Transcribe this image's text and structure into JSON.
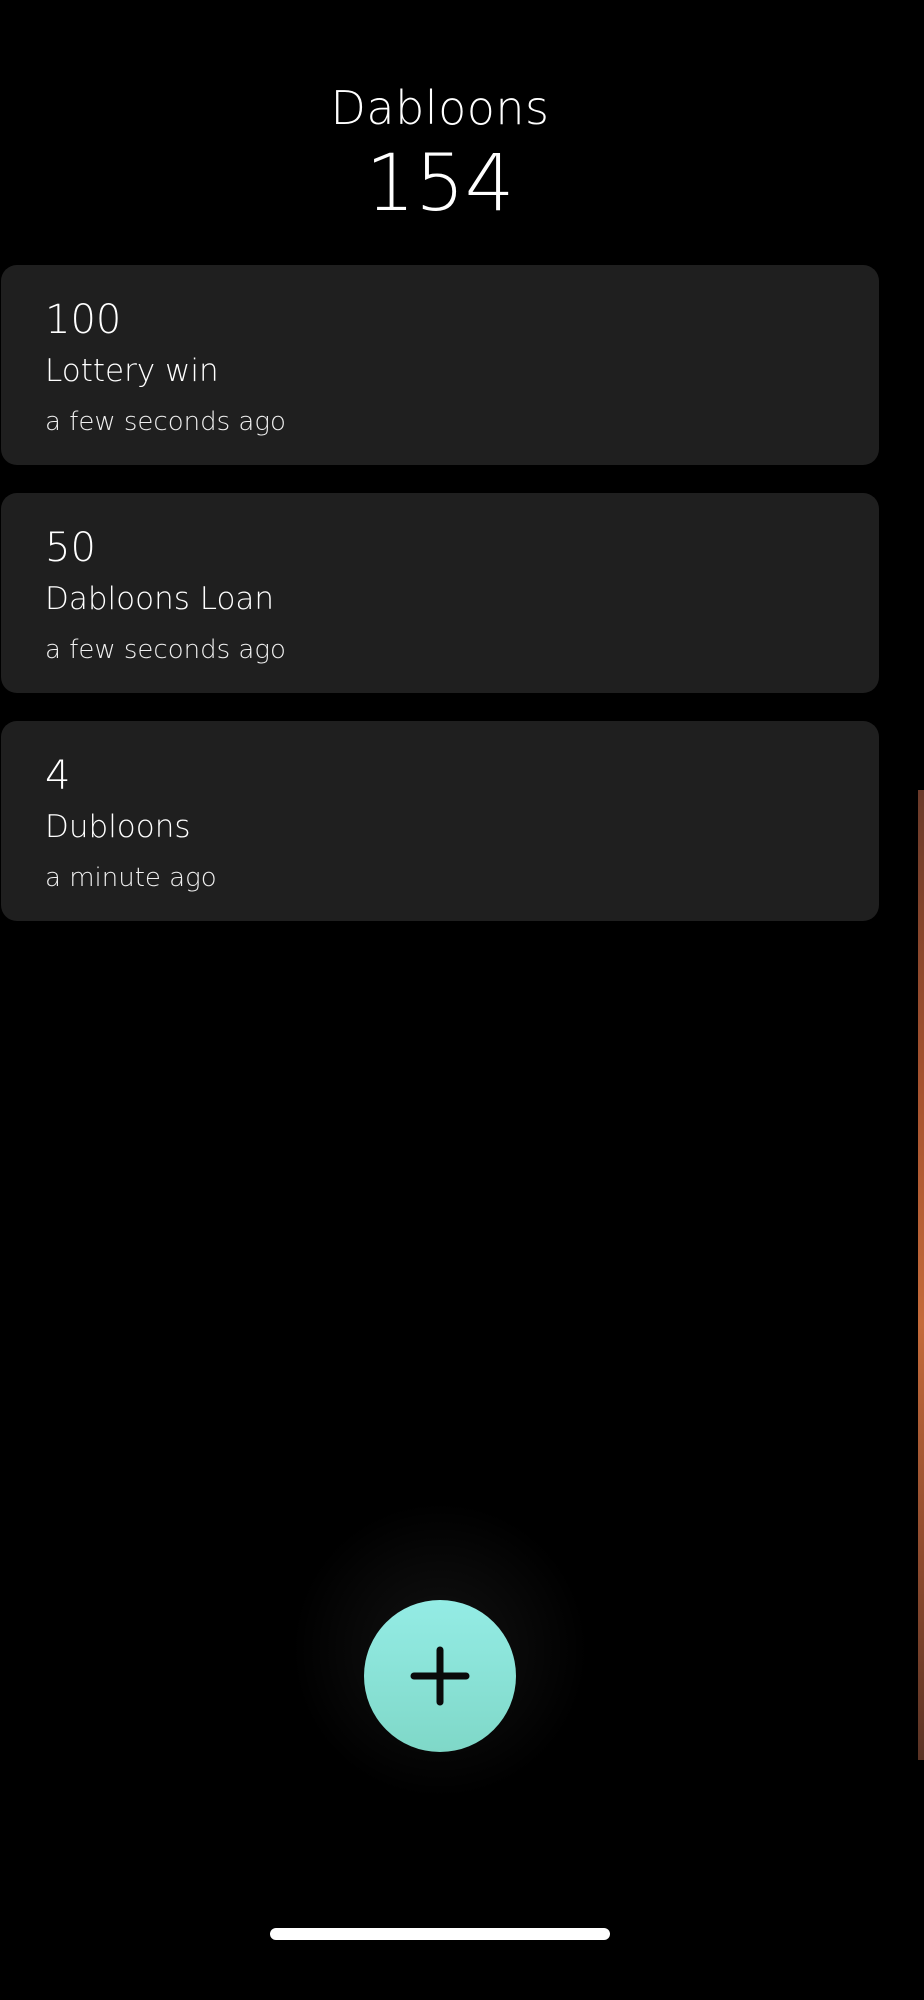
{
  "header": {
    "title": "Dabloons",
    "total": "154"
  },
  "transactions": [
    {
      "amount": "100",
      "label": "Lottery win",
      "time": "a few seconds ago"
    },
    {
      "amount": "50",
      "label": "Dabloons Loan",
      "time": "a few seconds ago"
    },
    {
      "amount": "4",
      "label": "Dubloons",
      "time": "a minute ago"
    }
  ],
  "fab": {
    "icon": "plus-icon",
    "color": "#8ee6dc"
  },
  "colors": {
    "background": "#000000",
    "card": "#1f1f1f",
    "text": "#ffffff",
    "accent": "#8ee6dc"
  }
}
